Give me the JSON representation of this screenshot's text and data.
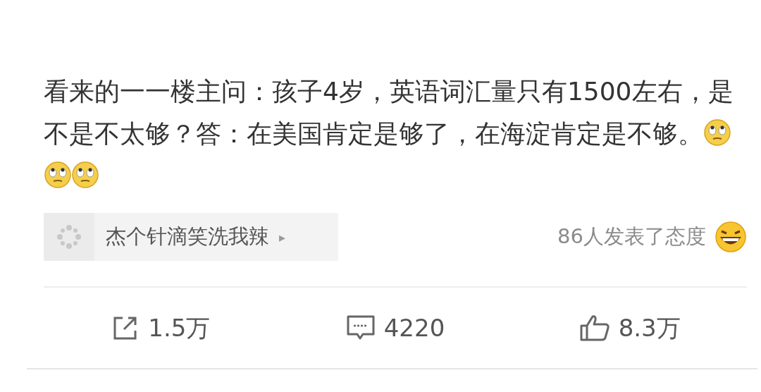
{
  "post": {
    "text": "看来的一一楼主问：孩子4岁，英语词汇量只有1500左右，是不是不太够？答：在美国肯定是够了，在海淀肯定是不够。",
    "emojis": [
      {
        "kind": "eye-roll"
      },
      {
        "kind": "eye-roll"
      },
      {
        "kind": "eye-roll"
      }
    ]
  },
  "topic": {
    "label": "杰个针滴笑洗我辣",
    "arrow": "▸"
  },
  "reactions": {
    "text": "86人发表了态度",
    "emoji": {
      "kind": "laugh"
    }
  },
  "actions": [
    {
      "kind": "share",
      "count": "1.5万"
    },
    {
      "kind": "comment",
      "count": "4220"
    },
    {
      "kind": "like",
      "count": "8.3万"
    }
  ]
}
